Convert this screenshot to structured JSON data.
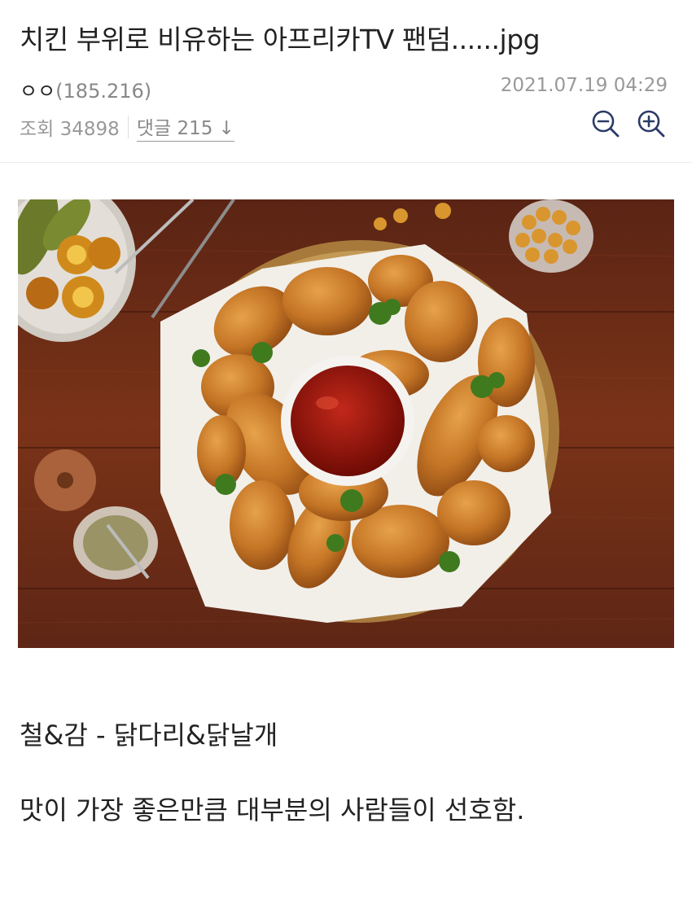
{
  "post": {
    "title": "치킨 부위로 비유하는 아프리카TV 팬덤......jpg",
    "author_name": "ㅇㅇ",
    "author_ip": "(185.216)",
    "datetime": "2021.07.19 04:29",
    "views_label": "조회 34898",
    "comments_label": "댓글 215",
    "comments_arrow": "↓"
  },
  "toolbar": {
    "zoom_out_icon": "zoom-out-icon",
    "zoom_in_icon": "zoom-in-icon",
    "icon_color": "#2b3a67"
  },
  "body": {
    "line1": "철&감 - 닭다리&닭날개",
    "line2": "맛이 가장 좋은만큼 대부분의 사람들이 선호함."
  },
  "colors": {
    "wood": "#6b2c17",
    "sauce": "#a1170f",
    "chicken": "#c8782a"
  }
}
